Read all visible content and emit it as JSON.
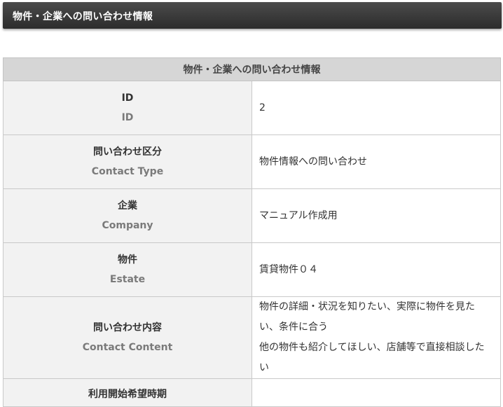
{
  "header": {
    "title": "物件・企業への問い合わせ情報"
  },
  "table": {
    "caption": "物件・企業への問い合わせ情報",
    "rows": [
      {
        "label_ja": "ID",
        "label_en": "ID",
        "value": "2"
      },
      {
        "label_ja": "問い合わせ区分",
        "label_en": "Contact Type",
        "value": "物件情報への問い合わせ"
      },
      {
        "label_ja": "企業",
        "label_en": "Company",
        "value": "マニュアル作成用"
      },
      {
        "label_ja": "物件",
        "label_en": "Estate",
        "value": "賃貸物件０４"
      },
      {
        "label_ja": "問い合わせ内容",
        "label_en": "Contact Content",
        "value": "物件の詳細・状況を知りたい、実際に物件を見たい、条件に合う\n他の物件も紹介してほしい、店舗等で直接相談したい"
      },
      {
        "label_ja": "利用開始希望時期",
        "label_en": "",
        "value": ""
      }
    ]
  }
}
